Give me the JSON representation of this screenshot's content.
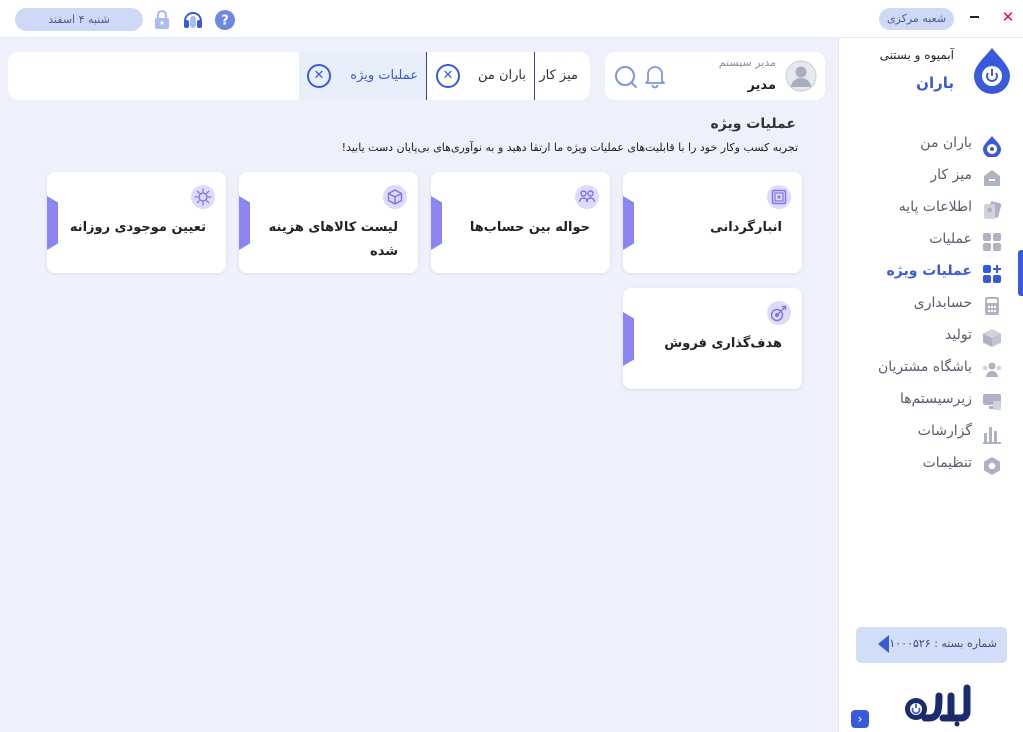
{
  "topbar": {
    "date": "شنبه ۴ اسفند",
    "branch": "شعبه مرکزی",
    "close_symbol": "✕"
  },
  "sidebar": {
    "brand_sub": "آبمیوه و بستنی",
    "brand_name": "باران",
    "items": [
      {
        "label": "باران من",
        "icon": "baran-logo-icon"
      },
      {
        "label": "میز کار",
        "icon": "home-icon"
      },
      {
        "label": "اطلاعات پایه",
        "icon": "info-cards-icon"
      },
      {
        "label": "عملیات",
        "icon": "grid-icon"
      },
      {
        "label": "عملیات ویژه",
        "icon": "grid-plus-icon",
        "active": true
      },
      {
        "label": "حسابداری",
        "icon": "calculator-icon"
      },
      {
        "label": "تولید",
        "icon": "box-icon"
      },
      {
        "label": "باشگاه مشتریان",
        "icon": "customers-icon"
      },
      {
        "label": "زیرسیستم‌ها",
        "icon": "subsystems-icon"
      },
      {
        "label": "گزارشات",
        "icon": "bar-chart-icon"
      },
      {
        "label": "تنظیمات",
        "icon": "settings-hex-icon"
      }
    ],
    "package_label": "شماره بسته : ۱۰۰۰۵۲۶",
    "collapse_symbol": "›"
  },
  "tabs": {
    "desk": "میز کار",
    "mine": "باران من",
    "special": "عملیات ویژه",
    "close_symbol": "✕"
  },
  "user": {
    "role": "مدیر سیستم",
    "name": "مدیر"
  },
  "page": {
    "title": "عملیات ویژه",
    "subtitle": "تجربه کسب وکار خود را با قابلیت‌های عملیات ویژه ما ارتقا دهید و به نوآوری‌های بی‌پایان دست یابید!"
  },
  "cards": [
    {
      "label": "انبارگردانی",
      "icon": "safe-icon"
    },
    {
      "label": "حواله بین حساب‌ها",
      "icon": "users-transfer-icon"
    },
    {
      "label": "لیست کالاهای هزینه شده",
      "icon": "package-icon"
    },
    {
      "label": "تعیین موجودی روزانه",
      "icon": "sun-icon"
    },
    {
      "label": "هدف‌گذاری فروش",
      "icon": "target-icon"
    }
  ],
  "colors": {
    "accent": "#3a5bd9",
    "card_tab": "#8c84f2",
    "background": "#eef1fb",
    "close_red": "#e3132c"
  }
}
